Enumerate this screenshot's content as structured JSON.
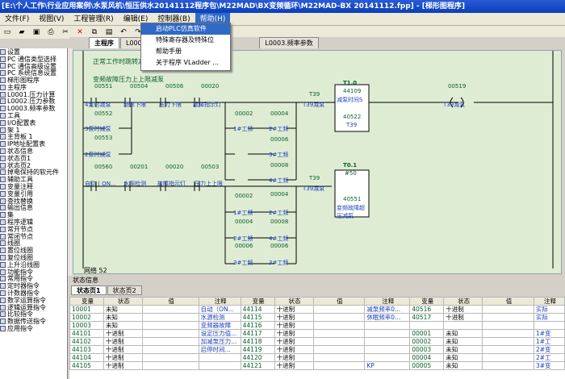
{
  "window": {
    "title": "[E:\\个人工作\\行业应用案例\\水泵风机\\恒压供水20141112程序包\\M22MAD\\BX变频循环\\M22MAD-BX 20141112.fpp] - [梯形图程序]"
  },
  "menubar": {
    "items": [
      "文件(F)",
      "视图(V)",
      "工程管理(R)",
      "编辑(E)",
      "控制器(B)",
      "帮助(H)"
    ]
  },
  "help_menu": {
    "items": [
      "启动PLC仿真软件",
      "特殊寄存器及特殊位",
      "帮助手册",
      "关于程序 VLadder ..."
    ]
  },
  "tabs": [
    {
      "label": "主程序"
    },
    {
      "label": "L000..."
    },
    {
      "label": "L0003.频率参数"
    }
  ],
  "sidebar": {
    "items": [
      "设置",
      "PC 通信类型选择",
      "PC 通信高级设置",
      "PC 系统信息设置",
      "梯形图程序",
      "主程序",
      "L0001.压力计算",
      "L0002.压力参数",
      "L0003.频率参数",
      "工具",
      "I/O配置表",
      "架 1",
      "主背板 1",
      "IP地址配置表",
      "状态信息",
      "状态页1",
      "状态页2",
      "掉电保持的软元件",
      "辅助工具",
      "变量注释",
      "变量引用",
      "查找替换",
      "输出信息",
      "集",
      "程序逻辑",
      "常开节点",
      "常闭节点",
      "线圈",
      "置位线圈",
      "复位线圈",
      "上升沿线圈",
      "功能指令",
      "常用指令",
      "定时器指令",
      "计数器指令",
      "数学运算指令",
      "逻辑运算指令",
      "比较指令",
      "数据传送指令",
      "应用指令"
    ]
  },
  "ladder": {
    "header1": "正常工作时跳转减泵",
    "header2": "变频故障压力上上限减泵",
    "network_label": "网络 52",
    "contacts_row1": [
      "00551",
      "00504",
      "00506",
      "00020"
    ],
    "contacts_row1_labels": [
      "4泵时减泵",
      "频率下限",
      "压力下限",
      "故障指示灯"
    ],
    "contact_552": "00552",
    "contact_552_label": "3泵时减泵",
    "contact_553": "00553",
    "contact_553_label": "2泵时减泵",
    "coil_t39_top": "T39",
    "coil_t39_top_label": "T39减泵",
    "timer1_name": "T1.0",
    "timer1_reg": "44109",
    "timer1_label": "减泵时间S",
    "timer1_out": "40522",
    "timer1_out_label": "T39",
    "coil_top_right": "00519",
    "coil_top_right_label": "T39减泵",
    "pumps_a": [
      "00002",
      "00004",
      "00006",
      "00008"
    ],
    "pumps_a_labels": [
      "1#工频",
      "2#工频",
      "3#工频",
      "4#工频"
    ],
    "row2_contacts": [
      "00560",
      "00201",
      "00020",
      "00503"
    ],
    "row2_labels": [
      "自动 ( ON...",
      "水源检测",
      "故障指示灯",
      "压力上上限"
    ],
    "coil_t39_bottom": "T39",
    "coil_t39_bottom_label": "T39减泵",
    "timer2_name": "T0.1",
    "timer2_reg": "#50",
    "timer2_out": "40551",
    "timer2_out_label": "变频故障超压减泵",
    "pumps_b": [
      "00004",
      "00002",
      "00004",
      "00008",
      "00006",
      "00006"
    ],
    "pumps_b_labels": [
      "2#工频",
      "1#工频",
      "2#工频",
      "4#工频",
      "3#工频",
      "3#工频"
    ]
  },
  "status": {
    "title": "状态信息",
    "tabs": [
      "状态页1",
      "状态页2"
    ],
    "headers": [
      "变量",
      "状态",
      "值",
      "注释",
      "变量",
      "状态",
      "值",
      "注释",
      "变量",
      "状态",
      "值",
      "注释"
    ],
    "rows": [
      [
        "10001",
        "未知",
        "",
        "自动（ON...",
        "44114",
        "十进制",
        "",
        "减泵频率0...",
        "40516",
        "十进制",
        "",
        "实际"
      ],
      [
        "10002",
        "未知",
        "",
        "水源检测",
        "44115",
        "十进制",
        "",
        "休眠频率0...",
        "40517",
        "十进制",
        "",
        "实际"
      ],
      [
        "10003",
        "未知",
        "",
        "变频器故障",
        "44116",
        "十进制",
        "",
        "",
        "",
        "",
        "",
        ""
      ],
      [
        "44101",
        "十进制",
        "",
        "设定压力值...",
        "44117",
        "十进制",
        "",
        "",
        "00001",
        "未知",
        "",
        "1#变"
      ],
      [
        "44102",
        "十进制",
        "",
        "加减泵压力...",
        "44118",
        "十进制",
        "",
        "",
        "00002",
        "未知",
        "",
        "1#工"
      ],
      [
        "44103",
        "十进制",
        "",
        "启停时间...",
        "44119",
        "十进制",
        "",
        "",
        "00003",
        "未知",
        "",
        "2#变"
      ],
      [
        "44104",
        "十进制",
        "",
        "",
        "44120",
        "十进制",
        "",
        "",
        "00004",
        "未知",
        "",
        "2#工"
      ],
      [
        "44105",
        "十进制",
        "",
        "",
        "44121",
        "十进制",
        "",
        "KP",
        "00005",
        "未知",
        "",
        "3#变"
      ]
    ]
  },
  "colors": {
    "title": "#0a3fb8",
    "canvas": "#dfecd4",
    "wire": "#000000",
    "label_green": "#08602a",
    "label_blue": "#1c41b8"
  }
}
